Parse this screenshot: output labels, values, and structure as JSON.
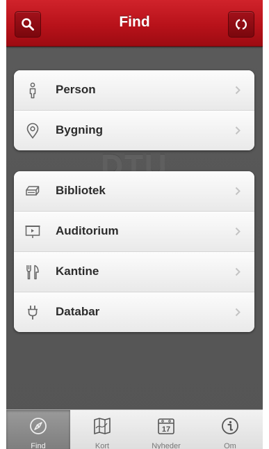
{
  "header": {
    "title": "Find",
    "search_icon": "search-icon",
    "refresh_icon": "refresh-icon"
  },
  "watermark": "DTU",
  "groups": [
    {
      "items": [
        {
          "label": "Person",
          "icon": "person-icon"
        },
        {
          "label": "Bygning",
          "icon": "location-pin-icon"
        }
      ]
    },
    {
      "items": [
        {
          "label": "Bibliotek",
          "icon": "book-icon"
        },
        {
          "label": "Auditorium",
          "icon": "projector-screen-icon"
        },
        {
          "label": "Kantine",
          "icon": "fork-knife-icon"
        },
        {
          "label": "Databar",
          "icon": "plug-icon"
        }
      ]
    }
  ],
  "tabs": [
    {
      "label": "Find",
      "icon": "compass-icon",
      "active": true
    },
    {
      "label": "Kort",
      "icon": "map-icon",
      "active": false
    },
    {
      "label": "Nyheder",
      "icon": "calendar-icon",
      "calendar_day": "17",
      "active": false
    },
    {
      "label": "Om",
      "icon": "info-icon",
      "active": false
    }
  ],
  "colors": {
    "header_red": "#b8121a",
    "background": "#575757",
    "row_text": "#2c2c2c"
  }
}
